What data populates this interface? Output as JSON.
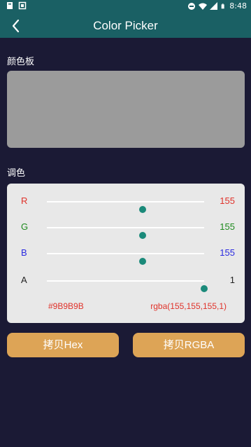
{
  "status_bar": {
    "time": "8:48"
  },
  "app_bar": {
    "title": "Color Picker"
  },
  "palette_label": "颜色板",
  "preview_color": "#9b9b9b",
  "adjust_label": "调色",
  "channels": [
    {
      "label": "R",
      "value": "155",
      "fraction": 0.608,
      "color": "#e0322a"
    },
    {
      "label": "G",
      "value": "155",
      "fraction": 0.608,
      "color": "#1e8a1e"
    },
    {
      "label": "B",
      "value": "155",
      "fraction": 0.608,
      "color": "#2a2ae0"
    },
    {
      "label": "A",
      "value": "1",
      "fraction": 1.0,
      "color": "#222222"
    }
  ],
  "hex_code": "#9B9B9B",
  "rgba_code": "rgba(155,155,155,1)",
  "buttons": {
    "copy_hex": "拷贝Hex",
    "copy_rgba": "拷贝RGBA"
  },
  "colors": {
    "background": "#1b1a35",
    "app_bar": "#1a6064",
    "panel": "#e8e8e8",
    "button": "#dda456",
    "thumb": "#1b8a7a"
  }
}
